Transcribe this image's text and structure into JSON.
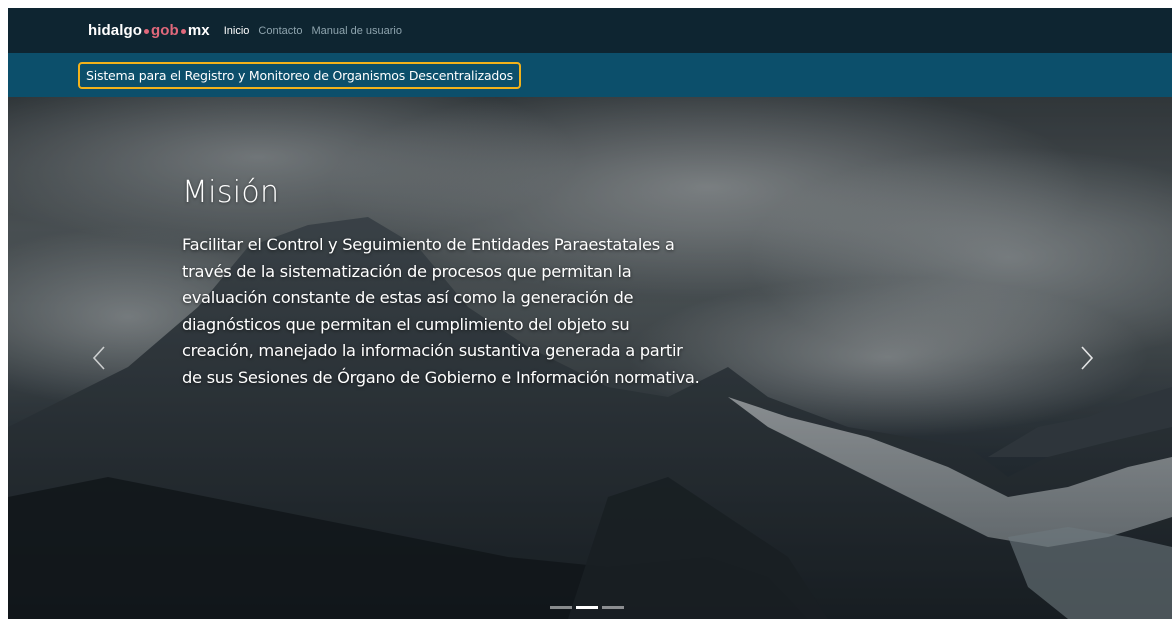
{
  "navbar": {
    "brand": {
      "part1": "hidalgo",
      "part2": "gob",
      "part3": "mx"
    },
    "links": [
      {
        "label": "Inicio",
        "active": true
      },
      {
        "label": "Contacto",
        "active": false
      },
      {
        "label": "Manual de usuario",
        "active": false
      }
    ]
  },
  "subheader": {
    "title": "Sistema para el Registro y Monitoreo de Organismos Descentralizados"
  },
  "carousel": {
    "slide": {
      "title": "Misión",
      "text": "Facilitar el Control y Seguimiento de Entidades Paraestatales a través de la sistematización de procesos que permitan la evaluación constante de estas así como la generación de diagnósticos que permitan el cumplimiento del objeto su creación, manejado la información sustantiva generada a partir de sus Sesiones de Órgano de Gobierno e Información normativa."
    },
    "prev_icon": "chevron-left-icon",
    "next_icon": "chevron-right-icon",
    "indicators": [
      {
        "active": false
      },
      {
        "active": true
      },
      {
        "active": false
      }
    ]
  },
  "colors": {
    "navbar_bg": "#0e2531",
    "subheader_bg": "#0c4f6b",
    "brand_accent": "#e0687b",
    "highlight_border": "#f2b21b"
  }
}
